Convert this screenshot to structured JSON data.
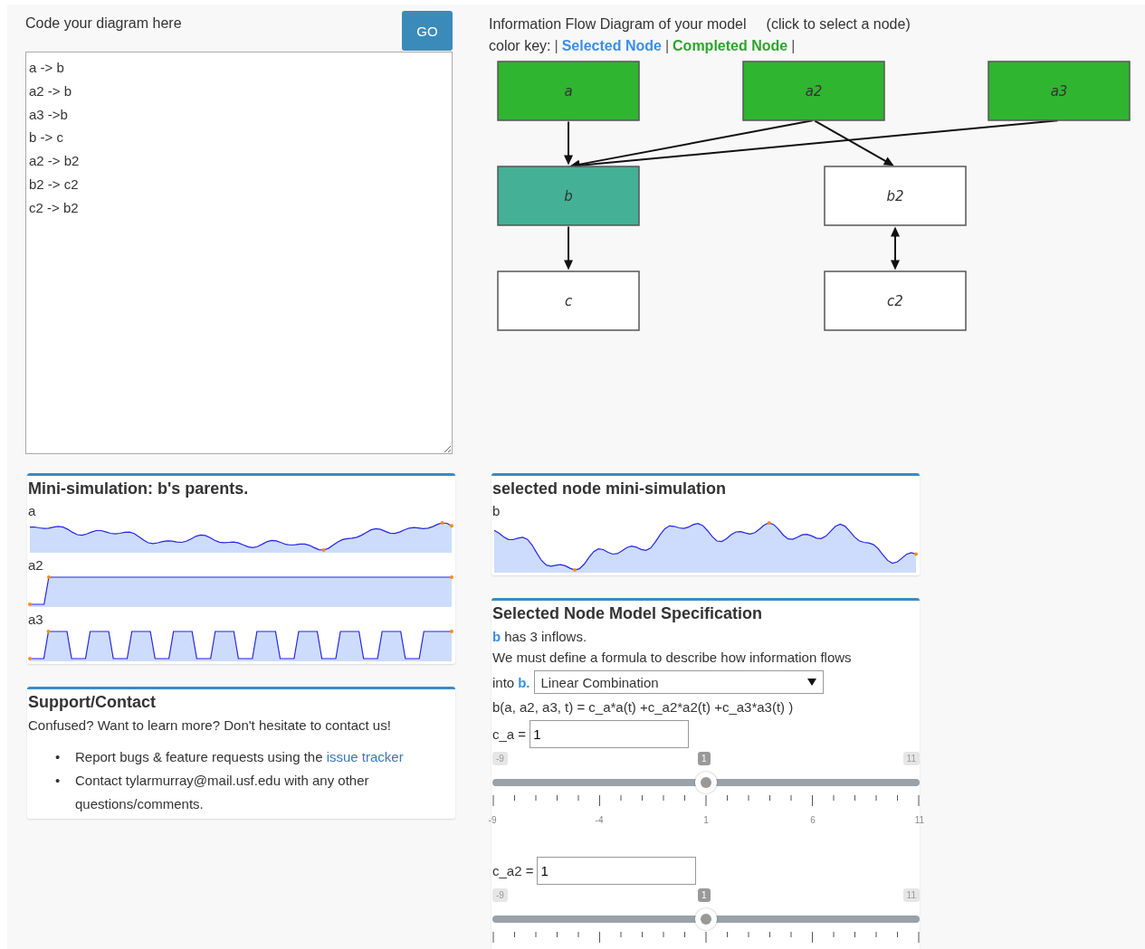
{
  "editor": {
    "label": "Code your diagram here",
    "go_button": "GO",
    "code": "a -> b\na2 -> b\na3 ->b\nb -> c\na2 -> b2\nb2 -> c2\nc2 -> b2"
  },
  "diagram": {
    "title": "Information Flow Diagram of your model",
    "hint": "(click to select a node)",
    "key_label": "color key:",
    "separator": "|",
    "key": [
      {
        "label": "Selected Node",
        "color": "#3a8ee6"
      },
      {
        "label": "Completed Node",
        "color": "#2ca52c"
      }
    ],
    "nodes": [
      {
        "name": "a",
        "selected": false,
        "completed": true
      },
      {
        "name": "a2",
        "selected": false,
        "completed": true
      },
      {
        "name": "a3",
        "selected": false,
        "completed": true
      },
      {
        "name": "b",
        "selected": true,
        "completed": false
      },
      {
        "name": "b2",
        "selected": false,
        "completed": false
      },
      {
        "name": "c",
        "selected": false,
        "completed": false
      },
      {
        "name": "c2",
        "selected": false,
        "completed": false
      }
    ]
  },
  "parents_sim": {
    "title": "Mini-simulation: b's parents.",
    "series": [
      {
        "name": "a",
        "kind": "walk"
      },
      {
        "name": "a2",
        "kind": "step"
      },
      {
        "name": "a3",
        "kind": "pulse"
      }
    ]
  },
  "node_sim": {
    "title": "selected node mini-simulation",
    "series": [
      {
        "name": "b",
        "kind": "walk"
      }
    ]
  },
  "support": {
    "title": "Support/Contact",
    "intro": "Confused? Want to learn more? Don't hesitate to contact us!",
    "items": [
      {
        "bullet": "•",
        "text": "Report bugs & feature requests using the ",
        "link": "issue tracker"
      },
      {
        "bullet": "•",
        "text": "Contact tylarmurray@mail.usf.edu with any other questions/comments."
      }
    ]
  },
  "spec": {
    "title": "Selected Node Model Specification",
    "node": "b",
    "inflows": "has 3 inflows.",
    "sentence": "We must define a formula to describe how information flows",
    "into": "into",
    "node_end": "b.",
    "method": "Linear Combination",
    "formula": "b(a, a2, a3, t) = c_a*a(t) +c_a2*a2(t) +c_a3*a3(t) )",
    "params": [
      {
        "label": "c_a =",
        "value": "1",
        "min": "-9",
        "max": "11",
        "current": "1",
        "level": 0.5,
        "tick_labels": [
          "-9",
          "-4",
          "1",
          "6",
          "11"
        ]
      },
      {
        "label": "c_a2 =",
        "value": "1",
        "min": "-9",
        "max": "11",
        "current": "1",
        "level": 0.5
      }
    ]
  }
}
